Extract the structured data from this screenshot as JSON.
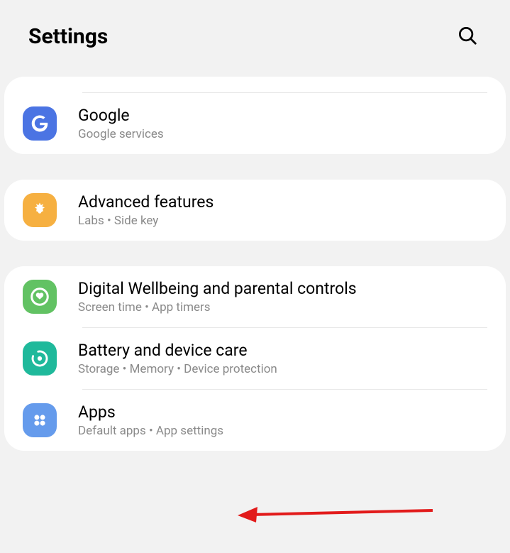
{
  "header": {
    "title": "Settings"
  },
  "groups": [
    {
      "items": [
        {
          "id": "google",
          "title": "Google",
          "subtitle": "Google services"
        }
      ]
    },
    {
      "items": [
        {
          "id": "advanced",
          "title": "Advanced features",
          "subtitle": "Labs  •  Side key"
        }
      ]
    },
    {
      "items": [
        {
          "id": "wellbeing",
          "title": "Digital Wellbeing and parental controls",
          "subtitle": "Screen time  •  App timers"
        },
        {
          "id": "battery",
          "title": "Battery and device care",
          "subtitle": "Storage  •  Memory  •  Device protection"
        },
        {
          "id": "apps",
          "title": "Apps",
          "subtitle": "Default apps  •  App settings"
        }
      ]
    }
  ]
}
